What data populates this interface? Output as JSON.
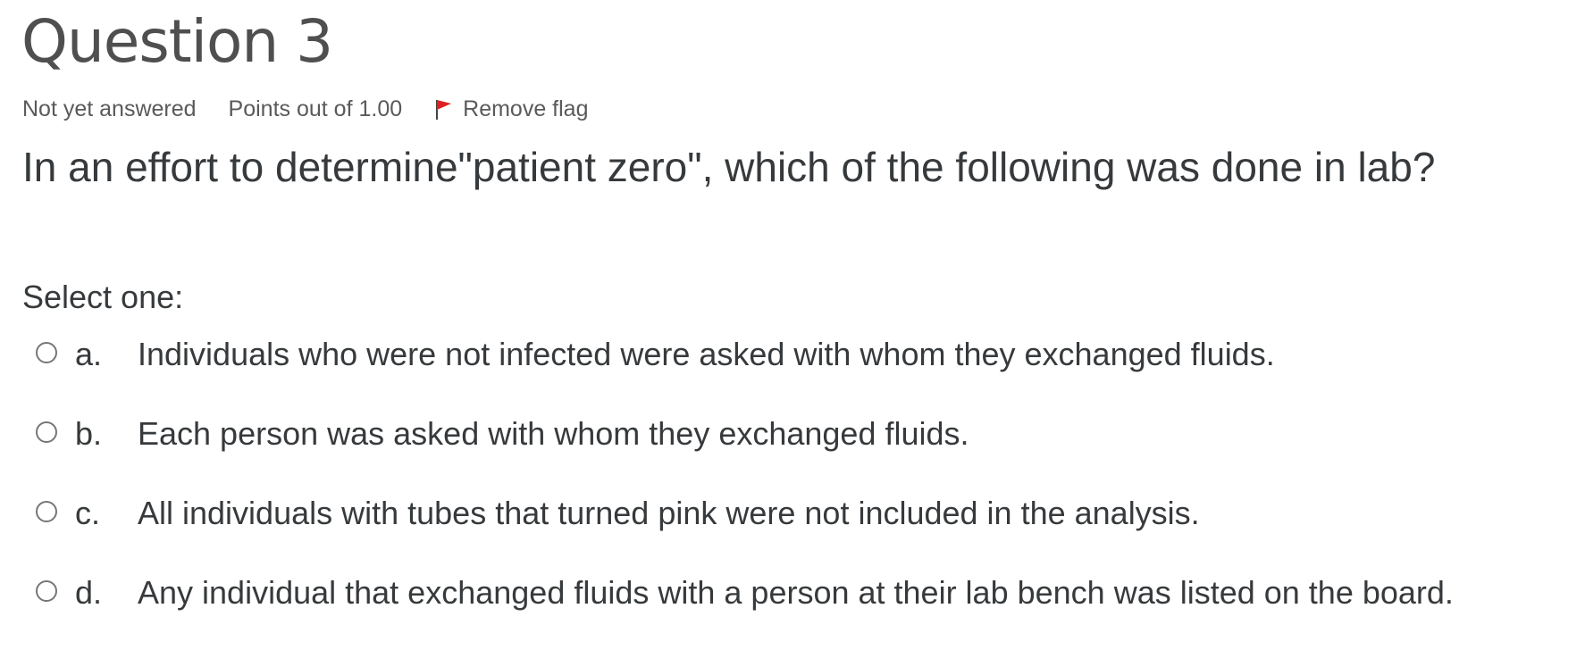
{
  "question": {
    "title": "Question 3",
    "state": "Not yet answered",
    "grade": "Points out of 1.00",
    "flag_label": "Remove flag",
    "text": "In an effort to determine\"patient zero\", which of the following was done in lab?",
    "prompt": "Select one:",
    "answers": [
      {
        "letter": "a.",
        "text": "Individuals who were not infected were asked with whom they exchanged fluids.",
        "selected": false
      },
      {
        "letter": "b.",
        "text": "Each person was asked with whom they exchanged fluids.",
        "selected": false
      },
      {
        "letter": "c.",
        "text": "All individuals with tubes that turned pink were not included in the analysis.",
        "selected": false
      },
      {
        "letter": "d.",
        "text": "Any individual that exchanged fluids with a person at their lab bench was listed on the board.",
        "selected": false
      }
    ]
  },
  "icons": {
    "flag": "flag-icon"
  },
  "colors": {
    "flag_red": "#e02020",
    "title_gray": "#4f4f4f",
    "text": "#373a3c"
  }
}
